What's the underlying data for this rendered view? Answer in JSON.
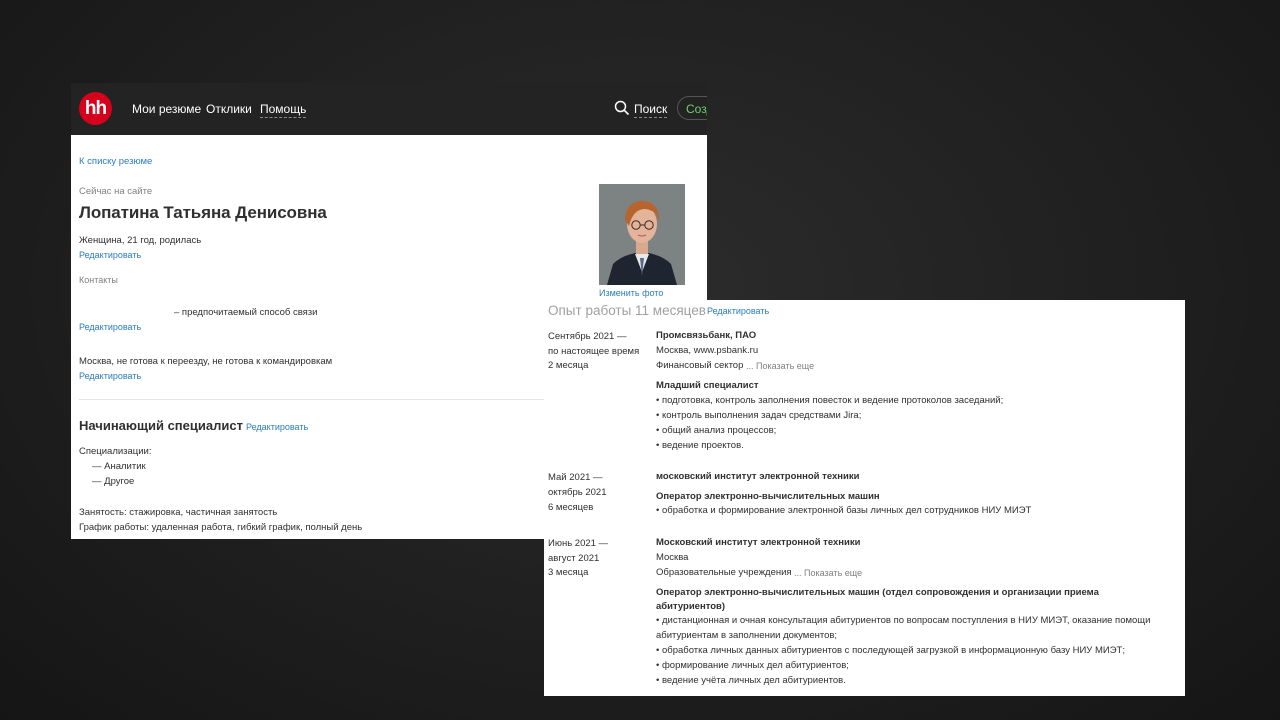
{
  "nav": {
    "logo": "hh",
    "my_resumes": "Мои резюме",
    "responses": "Отклики",
    "help": "Помощь",
    "search": "Поиск",
    "create": "Созд"
  },
  "profile": {
    "back_link": "К списку резюме",
    "online_status": "Сейчас на сайте",
    "full_name": "Лопатина Татьяна Денисовна",
    "gender_age": "Женщина, 21 год, родилась",
    "edit": "Редактировать",
    "contacts_label": "Контакты",
    "preferred_contact": "– предпочитаемый способ связи",
    "location": "Москва, не готова к переезду, не готова к командировкам",
    "change_photo": "Изменить фото"
  },
  "position": {
    "title": "Начинающий специалист",
    "edit": "Редактировать",
    "specializations_label": "Специализации:",
    "specializations": [
      "— Аналитик",
      "— Другое"
    ],
    "employment": "Занятость: стажировка, частичная занятость",
    "schedule": "График работы: удаленная работа, гибкий график, полный день"
  },
  "experience": {
    "title": "Опыт работы 11 месяцев",
    "edit": "Редактировать",
    "jobs": [
      {
        "period_start": "Сентябрь 2021 —",
        "period_end": "по настоящее время",
        "duration": "2 месяца",
        "company": "Промсвязьбанк, ПАО",
        "company_info": "Москва, www.psbank.ru",
        "industry": "Финансовый сектор",
        "show_more": "... Показать еще",
        "role": "Младший специалист",
        "duties": [
          "• подготовка, контроль заполнения повесток и ведение протоколов заседаний;",
          "• контроль выполнения задач средствами Jira;",
          "• общий анализ процессов;",
          "• ведение проектов."
        ]
      },
      {
        "period_start": "Май 2021 —",
        "period_end": "октябрь 2021",
        "duration": "6 месяцев",
        "company": "московский институт электронной техники",
        "role": "Оператор электронно-вычислительных машин",
        "duties": [
          "• обработка и формирование электронной базы личных дел сотрудников НИУ МИЭТ"
        ]
      },
      {
        "period_start": "Июнь 2021 —",
        "period_end": "август 2021",
        "duration": "3 месяца",
        "company": "Московский институт электронной техники",
        "company_info": "Москва",
        "industry": "Образовательные учреждения",
        "show_more": "... Показать еще",
        "role_line1": "Оператор электронно-вычислительных машин (отдел сопровождения и организации приема",
        "role_line2": "абитуриентов)",
        "duties": [
          "• дистанционная и очная консультация абитуриентов по вопросам поступления в НИУ МИЭТ, оказание помощи",
          "абитуриентам в заполнении документов;",
          "• обработка личных данных абитуриентов с последующей загрузкой в информационную базу НИУ МИЭТ;",
          "• формирование личных дел абитуриентов;",
          "• ведение учёта личных дел абитуриентов."
        ]
      }
    ]
  }
}
